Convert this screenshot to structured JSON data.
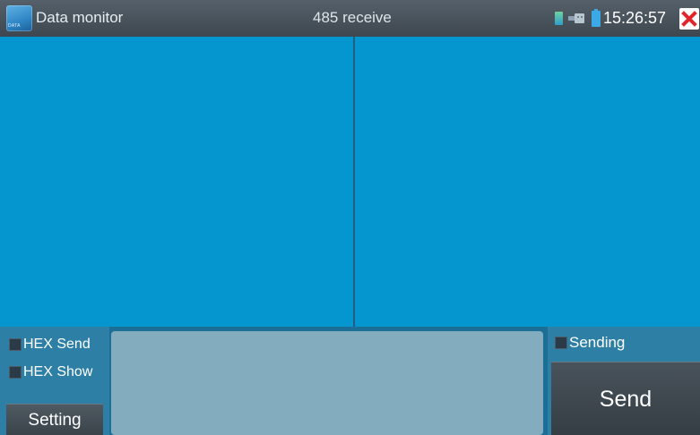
{
  "titlebar": {
    "app_title": "Data monitor",
    "app_icon": "data-monitor-app-icon",
    "app_icon_tag": "DATA",
    "mode_title": "485 receive",
    "time": "15:26:57",
    "status_icons": [
      "sd-card-icon",
      "usb-icon",
      "battery-icon"
    ],
    "close_icon": "close-icon"
  },
  "panes": {
    "receive_text": "",
    "send_text": ""
  },
  "controls": {
    "hex_send_label": "HEX Send",
    "hex_send_checked": false,
    "hex_show_label": "HEX Show",
    "hex_show_checked": false,
    "setting_label": "Setting",
    "input_value": "",
    "sending_label": "Sending",
    "sending_checked": false,
    "send_label": "Send"
  },
  "colors": {
    "titlebar": "#4a545d",
    "pane": "#0596cf",
    "bottom_panel": "#2d7fa6",
    "input": "#83adbf",
    "button": "#404950",
    "close": "#e0262b"
  }
}
